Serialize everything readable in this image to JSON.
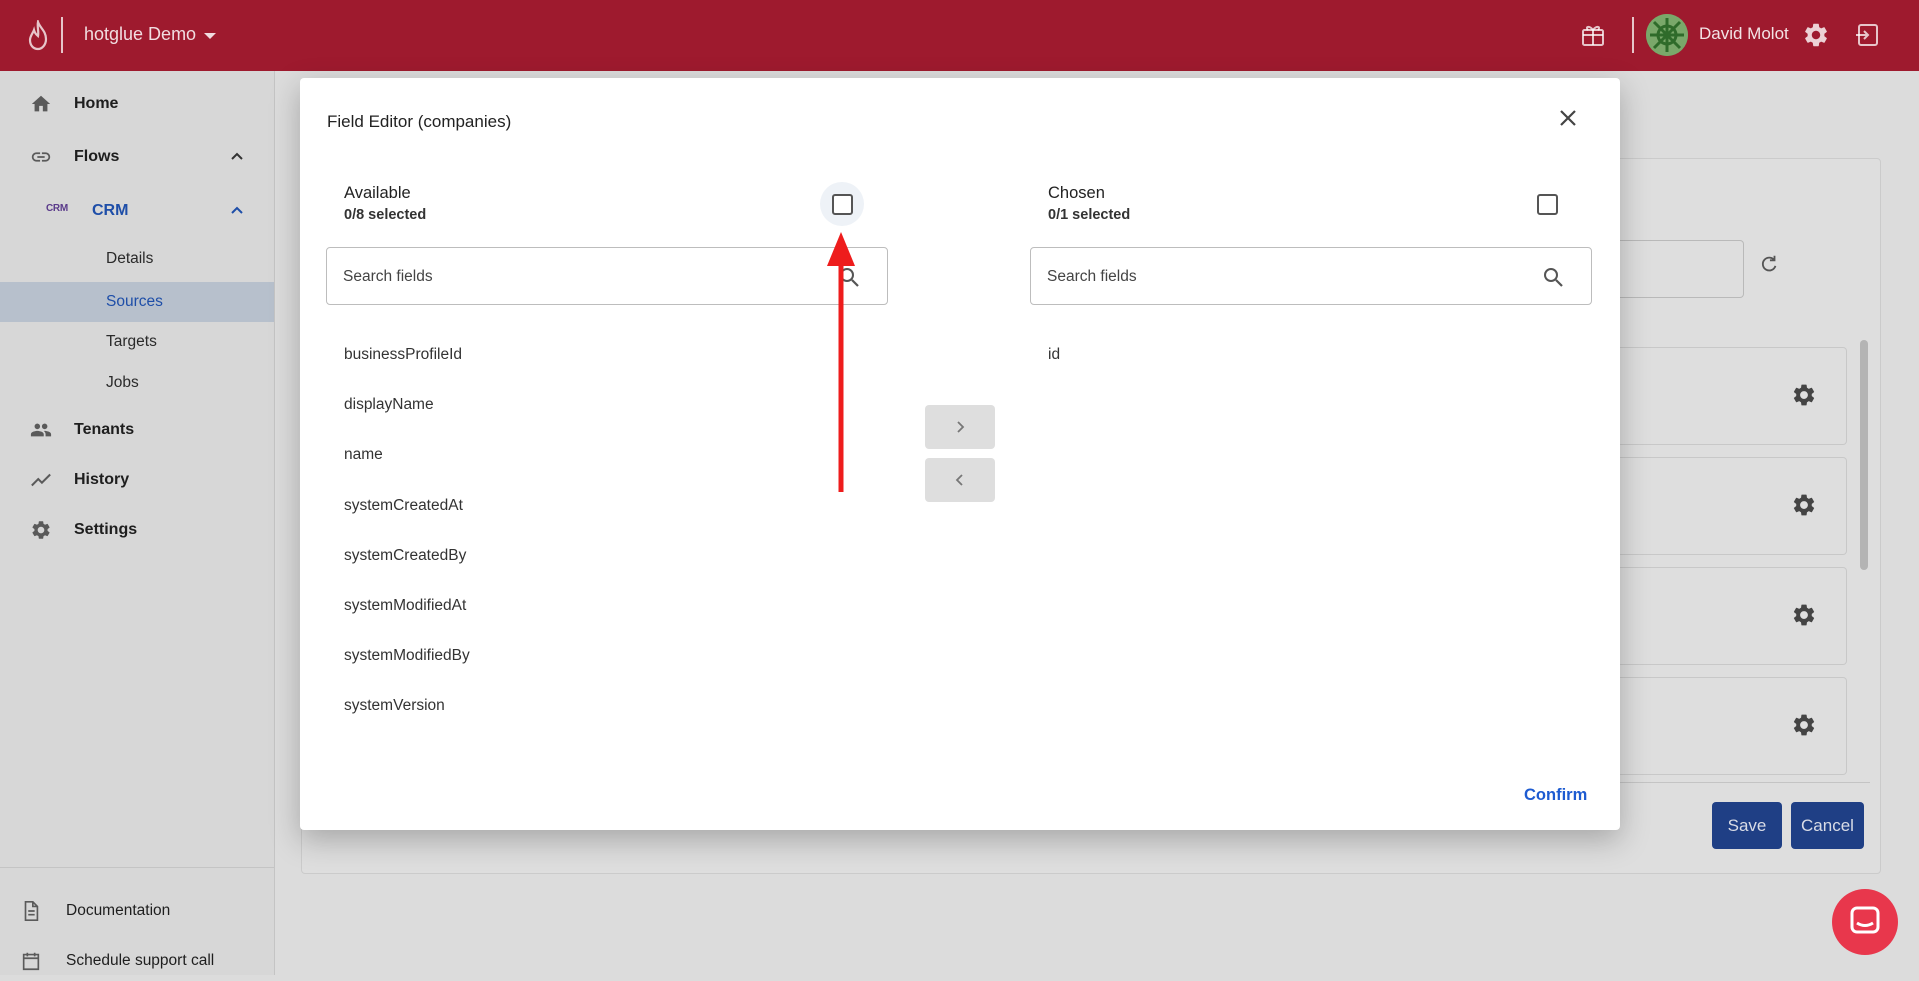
{
  "topbar": {
    "org_name": "hotglue Demo",
    "user_name": "David Molot",
    "icons": [
      "flame-logo-icon",
      "gift-icon",
      "gear-icon",
      "logout-icon"
    ]
  },
  "sidebar": {
    "items": [
      {
        "label": "Home",
        "icon": "home-icon"
      },
      {
        "label": "Flows",
        "icon": "link-icon"
      },
      {
        "label": "CRM",
        "icon": "crm-logo-icon"
      },
      {
        "label": "Details"
      },
      {
        "label": "Sources"
      },
      {
        "label": "Targets"
      },
      {
        "label": "Jobs"
      },
      {
        "label": "Tenants",
        "icon": "people-icon"
      },
      {
        "label": "History",
        "icon": "trending-icon"
      },
      {
        "label": "Settings",
        "icon": "gear-icon"
      }
    ],
    "crm_logo_text": "CRM",
    "footer": [
      {
        "label": "Documentation",
        "icon": "document-icon"
      },
      {
        "label": "Schedule support call",
        "icon": "calendar-icon"
      }
    ]
  },
  "background": {
    "save_label": "Save",
    "cancel_label": "Cancel"
  },
  "modal": {
    "title": "Field Editor (companies)",
    "available": {
      "title": "Available",
      "count": "0/8 selected",
      "search_placeholder": "Search fields",
      "fields": [
        "businessProfileId",
        "displayName",
        "name",
        "systemCreatedAt",
        "systemCreatedBy",
        "systemModifiedAt",
        "systemModifiedBy",
        "systemVersion"
      ]
    },
    "chosen": {
      "title": "Chosen",
      "count": "0/1 selected",
      "search_placeholder": "Search fields",
      "fields": [
        "id"
      ]
    },
    "confirm_label": "Confirm"
  },
  "colors": {
    "topbar": "#9e1a2e",
    "accent_blue": "#1d5bd1",
    "annotation_arrow": "#ee1c1c"
  }
}
